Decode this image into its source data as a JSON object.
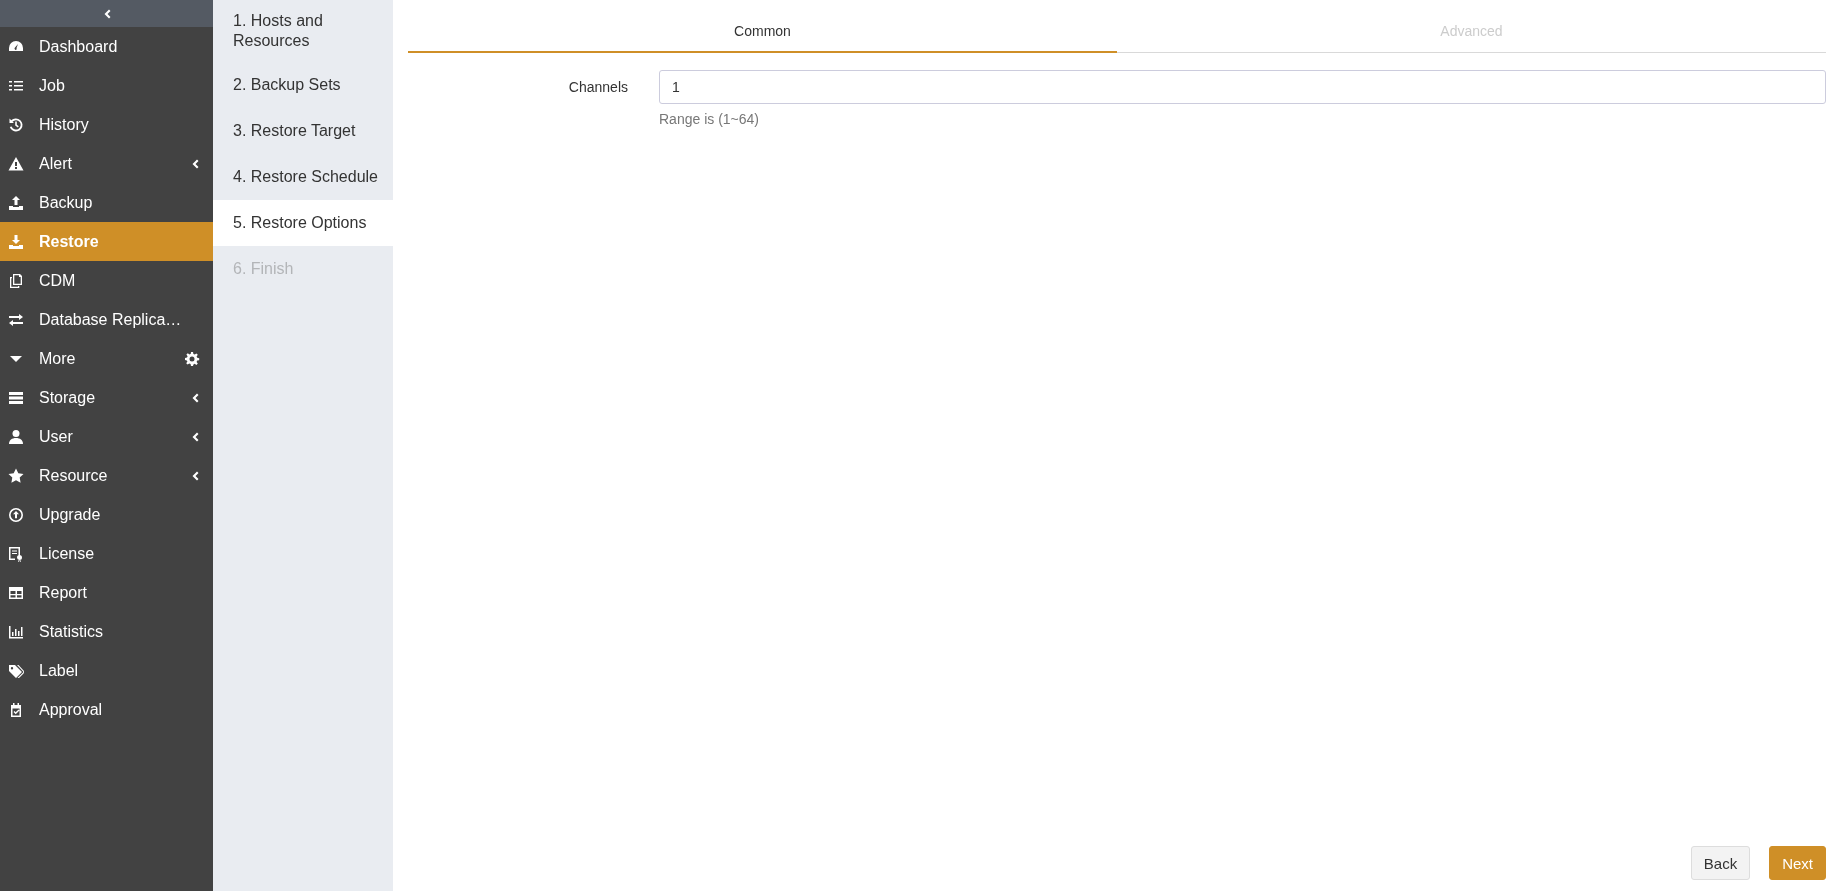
{
  "sidebar": {
    "items": [
      {
        "label": "Dashboard",
        "kind": "plain",
        "selected": false
      },
      {
        "label": "Job",
        "kind": "plain",
        "selected": false
      },
      {
        "label": "History",
        "kind": "plain",
        "selected": false
      },
      {
        "label": "Alert",
        "kind": "submenu",
        "selected": false
      },
      {
        "label": "Backup",
        "kind": "plain",
        "selected": false
      },
      {
        "label": "Restore",
        "kind": "plain",
        "selected": true
      },
      {
        "label": "CDM",
        "kind": "plain",
        "selected": false
      },
      {
        "label": "Database Replica…",
        "kind": "plain",
        "selected": false
      },
      {
        "label": "More",
        "kind": "settings",
        "selected": false
      },
      {
        "label": "Storage",
        "kind": "submenu",
        "selected": false
      },
      {
        "label": "User",
        "kind": "submenu",
        "selected": false
      },
      {
        "label": "Resource",
        "kind": "submenu",
        "selected": false
      },
      {
        "label": "Upgrade",
        "kind": "plain",
        "selected": false
      },
      {
        "label": "License",
        "kind": "plain",
        "selected": false
      },
      {
        "label": "Report",
        "kind": "plain",
        "selected": false
      },
      {
        "label": "Statistics",
        "kind": "plain",
        "selected": false
      },
      {
        "label": "Label",
        "kind": "plain",
        "selected": false
      },
      {
        "label": "Approval",
        "kind": "plain",
        "selected": false
      }
    ]
  },
  "steps": [
    {
      "label": "1. Hosts and Resources",
      "selected": false,
      "disabled": false
    },
    {
      "label": "2. Backup Sets",
      "selected": false,
      "disabled": false
    },
    {
      "label": "3. Restore Target",
      "selected": false,
      "disabled": false
    },
    {
      "label": "4. Restore Schedule",
      "selected": false,
      "disabled": false
    },
    {
      "label": "5. Restore Options",
      "selected": true,
      "disabled": false
    },
    {
      "label": "6. Finish",
      "selected": false,
      "disabled": true
    }
  ],
  "tabs": [
    {
      "label": "Common",
      "selected": true
    },
    {
      "label": "Advanced",
      "selected": false
    }
  ],
  "form": {
    "label": "Channels",
    "value": "1",
    "help": "Range is (1~64)"
  },
  "buttons": [
    {
      "label": "Back",
      "kind": "default"
    },
    {
      "label": "Next",
      "kind": "primary"
    }
  ]
}
